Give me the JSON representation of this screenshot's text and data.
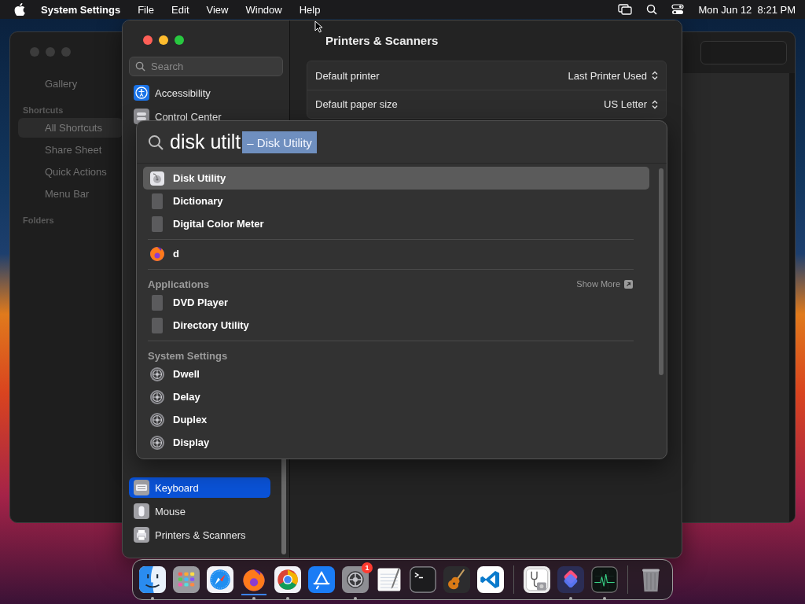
{
  "menu_bar": {
    "app": "System Settings",
    "menus": [
      "File",
      "Edit",
      "View",
      "Window",
      "Help"
    ],
    "clock": "Mon Jun 12  8:21 PM"
  },
  "shortcuts_window": {
    "top_items": [
      {
        "label": "Gallery",
        "selected": false
      }
    ],
    "sections": [
      {
        "title": "Shortcuts",
        "items": [
          {
            "label": "All Shortcuts",
            "selected": true
          },
          {
            "label": "Share Sheet",
            "selected": false
          },
          {
            "label": "Quick Actions",
            "selected": false
          },
          {
            "label": "Menu Bar",
            "selected": false
          }
        ]
      },
      {
        "title": "Folders"
      }
    ]
  },
  "settings_window": {
    "search": {
      "placeholder": "Search"
    },
    "sidebar_top": [
      {
        "label": "Accessibility",
        "selected": false
      },
      {
        "label": "Control Center",
        "selected": false
      }
    ],
    "sidebar_bottom": [
      {
        "label": "Keyboard",
        "selected": true
      },
      {
        "label": "Mouse",
        "selected": false
      },
      {
        "label": "Printers & Scanners",
        "selected": false
      }
    ],
    "pane_title": "Printers & Scanners",
    "settings": [
      {
        "label": "Default printer",
        "value": "Last Printer Used"
      },
      {
        "label": "Default paper size",
        "value": "US Letter"
      }
    ]
  },
  "spotlight": {
    "query": "disk utilt",
    "completion": "– Disk Utility",
    "groups": [
      {
        "items": [
          {
            "label": "Disk Utility",
            "selected": true
          },
          {
            "label": "Dictionary",
            "selected": false
          },
          {
            "label": "Digital Color Meter",
            "selected": false
          }
        ]
      },
      {
        "items": [
          {
            "label": "d",
            "selected": false
          }
        ]
      },
      {
        "title": "Applications",
        "action": "Show More",
        "items": [
          {
            "label": "DVD Player",
            "selected": false
          },
          {
            "label": "Directory Utility",
            "selected": false
          }
        ]
      },
      {
        "title": "System Settings",
        "items": [
          {
            "label": "Dwell",
            "selected": false
          },
          {
            "label": "Delay",
            "selected": false
          },
          {
            "label": "Duplex",
            "selected": false
          },
          {
            "label": "Display",
            "selected": false
          }
        ]
      }
    ]
  },
  "dock": {
    "groups": [
      {
        "items": [
          {
            "kind": "finder",
            "running": true,
            "hovered": false
          },
          {
            "kind": "launchpad",
            "running": false,
            "hovered": false
          },
          {
            "kind": "safari",
            "running": false,
            "hovered": false
          },
          {
            "kind": "firefox",
            "running": true,
            "hovered": true
          },
          {
            "kind": "chrome",
            "running": true,
            "hovered": false
          },
          {
            "kind": "appstore",
            "running": false,
            "hovered": false
          },
          {
            "kind": "settings",
            "running": true,
            "hovered": false,
            "badge": "1"
          },
          {
            "kind": "textedit",
            "running": false,
            "hovered": false
          },
          {
            "kind": "terminal",
            "running": false,
            "hovered": false
          },
          {
            "kind": "garageband",
            "running": false,
            "hovered": false
          },
          {
            "kind": "vscode",
            "running": false,
            "hovered": false
          }
        ]
      },
      {
        "items": [
          {
            "kind": "diskutility",
            "running": false,
            "hovered": false
          },
          {
            "kind": "shortcuts",
            "running": true,
            "hovered": false
          },
          {
            "kind": "activity",
            "running": true,
            "hovered": false
          }
        ]
      },
      {
        "items": [
          {
            "kind": "trash",
            "running": false,
            "hovered": false
          }
        ]
      }
    ]
  }
}
